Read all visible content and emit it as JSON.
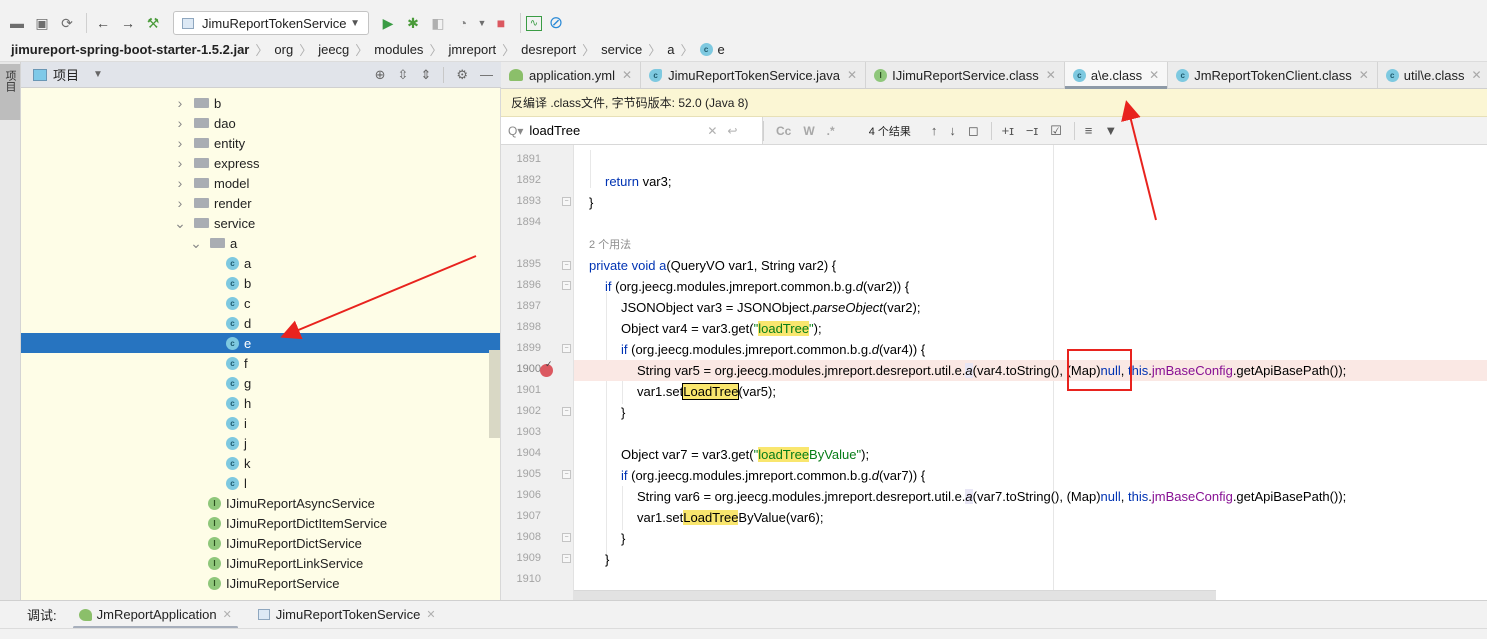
{
  "toolbar": {
    "run_config": "JimuReportTokenService",
    "icons": [
      "open-folder-icon",
      "save-icon",
      "sync-icon",
      "back-icon",
      "forward-icon",
      "build-hammer-icon",
      "run-icon",
      "debug-icon",
      "coverage-icon",
      "profile-icon",
      "stop-icon",
      "monitor-icon",
      "disable-icon"
    ]
  },
  "breadcrumb": {
    "items": [
      "jimureport-spring-boot-starter-1.5.2.jar",
      "org",
      "jeecg",
      "modules",
      "jmreport",
      "desreport",
      "service",
      "a",
      "e"
    ]
  },
  "left_strip": {
    "tab_label": "项目"
  },
  "project_panel": {
    "title": "项目",
    "tree": [
      {
        "label": "b",
        "type": "folder",
        "expanded": false,
        "depth": 0
      },
      {
        "label": "dao",
        "type": "folder",
        "expanded": false,
        "depth": 0
      },
      {
        "label": "entity",
        "type": "folder",
        "expanded": false,
        "depth": 0
      },
      {
        "label": "express",
        "type": "folder",
        "expanded": false,
        "depth": 0
      },
      {
        "label": "model",
        "type": "folder",
        "expanded": false,
        "depth": 0
      },
      {
        "label": "render",
        "type": "folder",
        "expanded": false,
        "depth": 0
      },
      {
        "label": "service",
        "type": "folder",
        "expanded": true,
        "depth": 0
      },
      {
        "label": "a",
        "type": "folder",
        "expanded": true,
        "depth": 1
      },
      {
        "label": "a",
        "type": "class",
        "depth": 2
      },
      {
        "label": "b",
        "type": "class",
        "depth": 2
      },
      {
        "label": "c",
        "type": "class",
        "depth": 2
      },
      {
        "label": "d",
        "type": "class",
        "depth": 2
      },
      {
        "label": "e",
        "type": "class",
        "depth": 2,
        "selected": true
      },
      {
        "label": "f",
        "type": "class",
        "depth": 2
      },
      {
        "label": "g",
        "type": "class",
        "depth": 2
      },
      {
        "label": "h",
        "type": "class",
        "depth": 2
      },
      {
        "label": "i",
        "type": "class",
        "depth": 2
      },
      {
        "label": "j",
        "type": "class",
        "depth": 2
      },
      {
        "label": "k",
        "type": "class",
        "depth": 2
      },
      {
        "label": "l",
        "type": "class",
        "depth": 2
      },
      {
        "label": "IJimuReportAsyncService",
        "type": "interface",
        "depth": 1
      },
      {
        "label": "IJimuReportDictItemService",
        "type": "interface",
        "depth": 1
      },
      {
        "label": "IJimuReportDictService",
        "type": "interface",
        "depth": 1
      },
      {
        "label": "IJimuReportLinkService",
        "type": "interface",
        "depth": 1
      },
      {
        "label": "IJimuReportService",
        "type": "interface",
        "depth": 1
      }
    ]
  },
  "editor_tabs": [
    {
      "label": "application.yml",
      "icon": "yml",
      "active": false
    },
    {
      "label": "JimuReportTokenService.java",
      "icon": "java",
      "active": false
    },
    {
      "label": "IJimuReportService.class",
      "icon": "interface",
      "active": false
    },
    {
      "label": "a\\e.class",
      "icon": "class",
      "active": true
    },
    {
      "label": "JmReportTokenClient.class",
      "icon": "class",
      "active": false
    },
    {
      "label": "util\\e.class",
      "icon": "class",
      "active": false
    }
  ],
  "banner": {
    "text": "反编译 .class文件, 字节码版本: 52.0 (Java 8)"
  },
  "search": {
    "value": "loadTree",
    "options": [
      "Cc",
      "W",
      ".*"
    ],
    "results": "4 个结果"
  },
  "code": {
    "usage_hint": "2 个用法",
    "lines": [
      {
        "n": "1891"
      },
      {
        "n": "1892"
      },
      {
        "n": "1893"
      },
      {
        "n": "1894"
      },
      {
        "n": "1895"
      },
      {
        "n": "1896"
      },
      {
        "n": "1897"
      },
      {
        "n": "1898"
      },
      {
        "n": "1899"
      },
      {
        "n": "1900",
        "breakpoint": true
      },
      {
        "n": "1901"
      },
      {
        "n": "1902"
      },
      {
        "n": "1903"
      },
      {
        "n": "1904"
      },
      {
        "n": "1905"
      },
      {
        "n": "1906"
      },
      {
        "n": "1907"
      },
      {
        "n": "1908"
      },
      {
        "n": "1909"
      },
      {
        "n": "1910"
      }
    ],
    "text": {
      "l1892_kw": "return",
      "l1892_rest": " var3;",
      "l1893": "}",
      "l1895_kw": "private void ",
      "l1895_fn": "a",
      "l1895_rest": "(QueryVO var1, String var2) {",
      "l1896_kw": "if",
      "l1896_a": " (org.jeecg.modules.jmreport.common.b.g.",
      "l1896_fn": "d",
      "l1896_b": "(var2)) {",
      "l1897_a": "JSONObject var3 = JSONObject.",
      "l1897_fn": "parseObject",
      "l1897_b": "(var2);",
      "l1898_a": "Object var4 = var3.get(",
      "l1898_q1": "\"",
      "l1898_hl": "loadTree",
      "l1898_q2": "\"",
      "l1898_b": ");",
      "l1899_kw": "if",
      "l1899_a": " (org.jeecg.modules.jmreport.common.b.g.",
      "l1899_fn": "d",
      "l1899_b": "(var4)) {",
      "l1900_a": "String var5 = org.jeecg.modules.jmreport.desreport.util.e.",
      "l1900_fn": "a",
      "l1900_b": "(var4.toString(), (Map)",
      "l1900_null": "null",
      "l1900_c": ", ",
      "l1900_this": "this",
      "l1900_d": ".",
      "l1900_fld": "jmBaseConfig",
      "l1900_e": ".getApiBasePath());",
      "l1901_a": "var1.set",
      "l1901_hl": "LoadTree",
      "l1901_b": "(var5);",
      "l1902": "}",
      "l1904_a": "Object var7 = var3.get(",
      "l1904_q1": "\"",
      "l1904_hl": "loadTree",
      "l1904_str": "ByValue",
      "l1904_q2": "\"",
      "l1904_b": ");",
      "l1905_kw": "if",
      "l1905_a": " (org.jeecg.modules.jmreport.common.b.g.",
      "l1905_fn": "d",
      "l1905_b": "(var7)) {",
      "l1906_a": "String var6 = org.jeecg.modules.jmreport.desreport.util.e.",
      "l1906_fn": "a",
      "l1906_b": "(var7.toString(), (Map)",
      "l1906_null": "null",
      "l1906_c": ", ",
      "l1906_this": "this",
      "l1906_d": ".",
      "l1906_fld": "jmBaseConfig",
      "l1906_e": ".getApiBasePath());",
      "l1907_a": "var1.set",
      "l1907_hl": "LoadTree",
      "l1907_b": "ByValue(var6);",
      "l1908": "}",
      "l1909": "}"
    }
  },
  "debug": {
    "label": "调试:",
    "tabs": [
      {
        "label": "JmReportApplication",
        "active": true
      },
      {
        "label": "JimuReportTokenService",
        "active": false
      }
    ]
  },
  "colors": {
    "selection": "#2774c0",
    "annotation_red": "#e8231e",
    "search_highlight": "#f9e66e",
    "keyword": "#0033b3",
    "string": "#067d17",
    "field": "#871094"
  }
}
